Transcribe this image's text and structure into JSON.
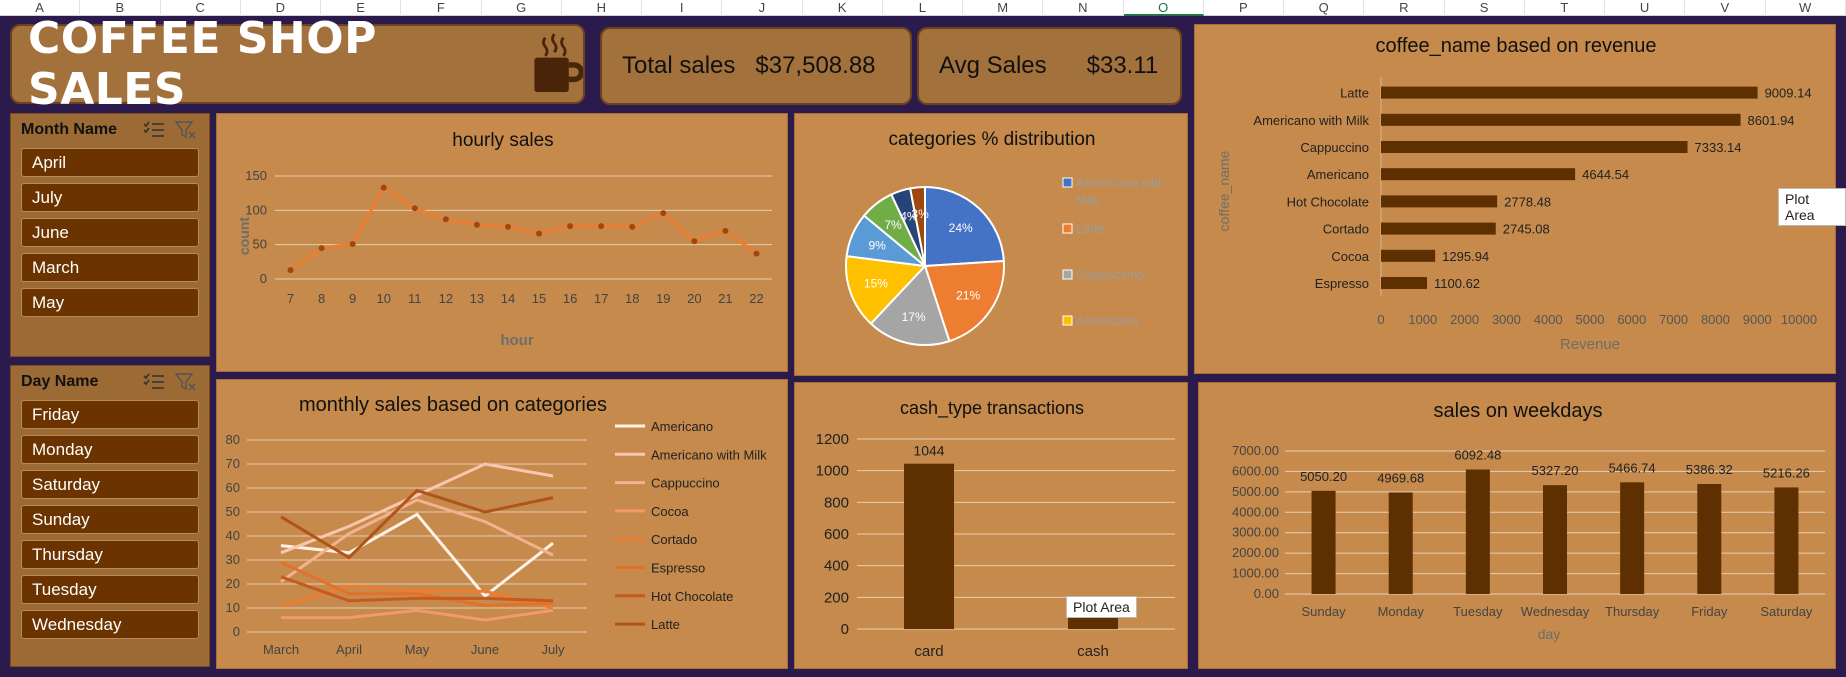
{
  "sheet": {
    "columns": [
      "A",
      "B",
      "C",
      "D",
      "E",
      "F",
      "G",
      "H",
      "I",
      "J",
      "K",
      "L",
      "M",
      "N",
      "O",
      "P",
      "Q",
      "R",
      "S",
      "T",
      "U",
      "V",
      "W"
    ],
    "selected_column": "O"
  },
  "header": {
    "title": "COFFEE SHOP SALES",
    "icon": "coffee-mug-icon",
    "total_sales_label": "Total sales",
    "total_sales_value": "$37,508.88",
    "avg_sales_label": "Avg Sales",
    "avg_sales_value": "$33.11"
  },
  "slicers": {
    "month": {
      "title": "Month Name",
      "items": [
        "April",
        "July",
        "June",
        "March",
        "May"
      ]
    },
    "day": {
      "title": "Day Name",
      "items": [
        "Friday",
        "Monday",
        "Saturday",
        "Sunday",
        "Thursday",
        "Tuesday",
        "Wednesday"
      ]
    }
  },
  "tooltips": {
    "plot_area": "Plot Area"
  },
  "colors": {
    "background": "#2b1a4c",
    "card": "#c58a4c",
    "banner": "#a3713c",
    "bar": "#5e2f00",
    "line": "#ed7d31",
    "slicer_item": "#6b3300"
  },
  "chart_data": [
    {
      "id": "hourly",
      "type": "line",
      "title": "hourly sales",
      "xlabel": "hour",
      "ylabel": "count",
      "x": [
        7,
        8,
        9,
        10,
        11,
        12,
        13,
        14,
        15,
        16,
        17,
        18,
        19,
        20,
        21,
        22
      ],
      "values": [
        13,
        45,
        51,
        133,
        103,
        87,
        79,
        76,
        66,
        77,
        77,
        76,
        96,
        55,
        70,
        37
      ],
      "ylim": [
        0,
        150
      ],
      "yticks": [
        0,
        50,
        100,
        150
      ],
      "grid": true
    },
    {
      "id": "categories",
      "type": "pie",
      "title": "categories % distribution",
      "legend": [
        "Americano with Milk",
        "Latte",
        "Cappuccino",
        "Americano"
      ],
      "legend_position": "right",
      "slices": [
        {
          "label": "24%",
          "value": 24,
          "color": "#4472c4"
        },
        {
          "label": "21%",
          "value": 21,
          "color": "#ed7d31"
        },
        {
          "label": "17%",
          "value": 17,
          "color": "#a5a5a5"
        },
        {
          "label": "15%",
          "value": 15,
          "color": "#ffc000"
        },
        {
          "label": "9%",
          "value": 9,
          "color": "#5b9bd5"
        },
        {
          "label": "7%",
          "value": 7,
          "color": "#70ad47"
        },
        {
          "label": "4%",
          "value": 4,
          "color": "#264478"
        },
        {
          "label": "3%",
          "value": 3,
          "color": "#9e480e"
        }
      ]
    },
    {
      "id": "coffee_revenue",
      "type": "bar",
      "orientation": "horizontal",
      "title": "coffee_name based on revenue",
      "xlabel": "Revenue",
      "ylabel": "coffee_name",
      "categories": [
        "Latte",
        "Americano with Milk",
        "Cappuccino",
        "Americano",
        "Hot Chocolate",
        "Cortado",
        "Cocoa",
        "Espresso"
      ],
      "values": [
        9009.14,
        8601.94,
        7333.14,
        4644.54,
        2778.48,
        2745.08,
        1295.94,
        1100.62
      ],
      "labels": [
        "9009.14",
        "8601.94",
        "7333.14",
        "4644.54",
        "2778.48",
        "2745.08",
        "1295.94",
        "1100.62"
      ],
      "xlim": [
        0,
        10000
      ],
      "xticks": [
        0,
        1000,
        2000,
        3000,
        4000,
        5000,
        6000,
        7000,
        8000,
        9000,
        10000
      ]
    },
    {
      "id": "monthly",
      "type": "line",
      "title": "monthly sales based on categories",
      "categories": [
        "March",
        "April",
        "May",
        "June",
        "July"
      ],
      "ylim": [
        0,
        80
      ],
      "yticks": [
        0,
        10,
        20,
        30,
        40,
        50,
        60,
        70,
        80
      ],
      "grid": true,
      "legend_position": "right",
      "series": [
        {
          "name": "Americano",
          "values": [
            36,
            33,
            49,
            15,
            37
          ],
          "color": "#fff1e6"
        },
        {
          "name": "Americano with Milk",
          "values": [
            33,
            44,
            57,
            70,
            65
          ],
          "color": "#f9c6b0"
        },
        {
          "name": "Cappuccino",
          "values": [
            21,
            41,
            55,
            46,
            32
          ],
          "color": "#f4b18f"
        },
        {
          "name": "Cocoa",
          "values": [
            6,
            6,
            9,
            5,
            9
          ],
          "color": "#f29a6c"
        },
        {
          "name": "Cortado",
          "values": [
            11,
            19,
            17,
            17,
            10
          ],
          "color": "#ed7d31"
        },
        {
          "name": "Espresso",
          "values": [
            29,
            16,
            16,
            11,
            12
          ],
          "color": "#e2722a"
        },
        {
          "name": "Hot Chocolate",
          "values": [
            23,
            13,
            14,
            14,
            13
          ],
          "color": "#c65a1e"
        },
        {
          "name": "Latte",
          "values": [
            48,
            31,
            59,
            50,
            56
          ],
          "color": "#b1541a"
        }
      ]
    },
    {
      "id": "cash_type",
      "type": "bar",
      "title": "cash_type transactions",
      "categories": [
        "card",
        "cash"
      ],
      "values": [
        1044,
        90
      ],
      "labels": [
        "1044",
        ""
      ],
      "ylim": [
        0,
        1200
      ],
      "yticks": [
        0,
        200,
        400,
        600,
        800,
        1000,
        1200
      ]
    },
    {
      "id": "weekdays",
      "type": "bar",
      "title": "sales on weekdays",
      "xlabel": "day",
      "categories": [
        "Sunday",
        "Monday",
        "Tuesday",
        "Wednesday",
        "Thursday",
        "Friday",
        "Saturday"
      ],
      "values": [
        5050.2,
        4969.68,
        6092.48,
        5327.2,
        5466.74,
        5386.32,
        5216.26
      ],
      "labels": [
        "5050.20",
        "4969.68",
        "6092.48",
        "5327.20",
        "5466.74",
        "5386.32",
        "5216.26"
      ],
      "ylim": [
        0,
        7000
      ],
      "yticks": [
        "0.00",
        "1000.00",
        "2000.00",
        "3000.00",
        "4000.00",
        "5000.00",
        "6000.00",
        "7000.00"
      ]
    }
  ]
}
